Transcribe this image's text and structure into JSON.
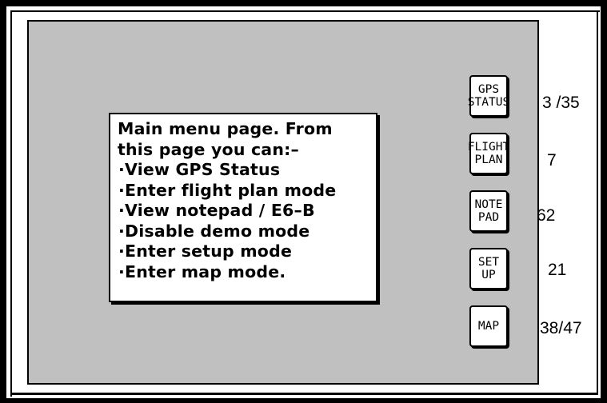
{
  "info": {
    "lines": [
      "Main menu page. From",
      "this page you can:–",
      "·View GPS Status",
      "·Enter flight plan mode",
      "·View notepad / E6–B",
      "·Disable demo mode",
      "·Enter setup mode",
      "·Enter map mode."
    ]
  },
  "buttons": [
    {
      "line1": "GPS",
      "line2": "STATUS",
      "count": "3 /35"
    },
    {
      "line1": "FLIGHT",
      "line2": "PLAN",
      "count": "7"
    },
    {
      "line1": "NOTE",
      "line2": "PAD",
      "count": "62"
    },
    {
      "line1": "SET",
      "line2": "UP",
      "count": "21"
    },
    {
      "line1": "MAP",
      "line2": "",
      "count": "38/47"
    }
  ],
  "colors": {
    "screen": "#c0c0c0",
    "frame": "#000000",
    "panel": "#ffffff"
  }
}
